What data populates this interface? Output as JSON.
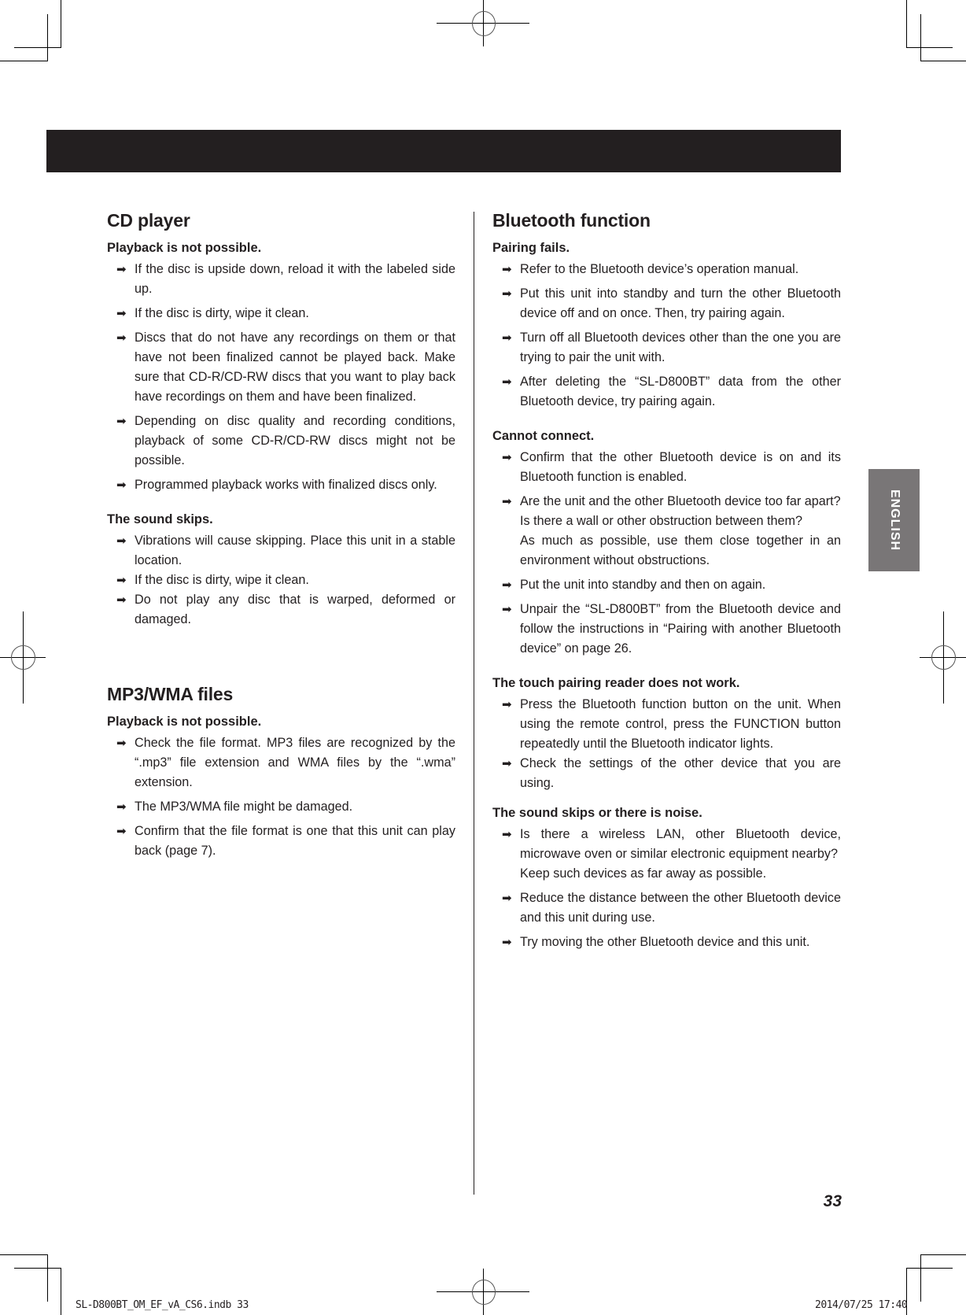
{
  "page": {
    "page_number": "33",
    "language_tab": "ENGLISH",
    "slug_left": "SL-D800BT_OM_EF_vA_CS6.indb   33",
    "slug_right": "2014/07/25   17:40",
    "colors": {
      "header_bar": "#231f20",
      "language_tab": "#797677",
      "text": "#231f20"
    }
  },
  "bullet_icon": "right-arrow-icon",
  "left_column": {
    "cd": {
      "title": "CD player",
      "p1": {
        "heading": "Playback is not possible.",
        "items": [
          "If the disc is upside down, reload it with the labeled side up.",
          "If the disc is dirty, wipe it clean.",
          "Discs that do not have any recordings on them or that have not been finalized cannot be played back. Make sure that CD-R/CD-RW discs that you want to play back have recordings on them and have been finalized.",
          "Depending on disc quality and recording conditions, playback of some CD-R/CD-RW discs might not be possible.",
          "Programmed playback works with finalized discs only."
        ]
      },
      "p2": {
        "heading": "The sound skips.",
        "items": [
          "Vibrations will cause skipping. Place this unit in a stable location.",
          "If the disc is dirty, wipe it clean.",
          "Do not play any disc that is warped, deformed or damaged."
        ]
      }
    },
    "mp3": {
      "title": "MP3/WMA files",
      "p1": {
        "heading": "Playback is not possible.",
        "items": [
          "Check the file format. MP3 files are recognized by the “.mp3” file extension and WMA files by the “.wma” extension.",
          "The MP3/WMA file might be damaged.",
          "Confirm that the file format is one that this unit can play back (page 7)."
        ]
      }
    }
  },
  "right_column": {
    "bt": {
      "title": "Bluetooth function",
      "p1": {
        "heading": "Pairing fails.",
        "items": [
          "Refer to the Bluetooth device’s operation manual.",
          "Put this unit into standby and turn the other Bluetooth device off and on once. Then, try pairing again.",
          "Turn off all Bluetooth devices other than the one you are trying to pair the unit with.",
          "After deleting the “SL-D800BT” data from the other Bluetooth device, try pairing again."
        ]
      },
      "p2": {
        "heading": "Cannot connect.",
        "items": [
          "Confirm that the other Bluetooth device is on and its Bluetooth function is enabled.",
          "Are the unit and the other Bluetooth device too far apart?",
          "Put the unit into standby and then on again.",
          "Unpair the “SL-D800BT” from the Bluetooth device and follow the instructions in “Pairing with another Bluetooth device” on page 26."
        ],
        "item2_sub1": "Is there a wall or other obstruction between them?",
        "item2_sub2": "As much as possible, use them close together in an environment without obstructions."
      },
      "p3": {
        "heading": "The touch pairing reader does not work.",
        "items": [
          "Press the Bluetooth function button on the unit. When using the remote control, press the FUNCTION button repeatedly until the Bluetooth indicator lights.",
          "Check the settings of the other device that you are using."
        ]
      },
      "p4": {
        "heading": "The sound skips or there is noise.",
        "items": [
          "Is there a wireless LAN, other Bluetooth device, microwave oven or similar electronic equipment nearby?",
          "Reduce the distance between the other Bluetooth device and this unit during use.",
          "Try moving the other Bluetooth device and this unit."
        ],
        "item1_sub1": "Keep such devices as far away as possible."
      }
    }
  }
}
